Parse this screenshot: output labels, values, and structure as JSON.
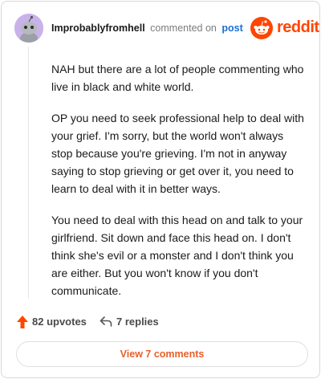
{
  "comment": {
    "username": "Improbablyfromhell",
    "action_text": "commented on",
    "post_link": "post",
    "avatar_icon": "snoo-avatar-icon",
    "paragraphs": [
      "NAH but there are a lot of people commenting who live in black and white world.",
      "OP you need to seek professional help to deal with your grief. I'm sorry, but the world won't always stop because you're grieving. I'm not in anyway saying to stop grieving or get over it, you need to learn to deal with it in better ways.",
      "You need to deal with this head on and talk to your girlfriend. Sit down and face this head on. I don't think she's evil or a monster and I don't think you are either. But you won't know if you don't communicate."
    ]
  },
  "brand": {
    "logo_text": "reddit",
    "logo_icon": "reddit-logo-icon",
    "color": "#ff4500"
  },
  "actions": {
    "upvotes": "82 upvotes",
    "upvote_icon": "upvote-arrow-icon",
    "replies": "7 replies",
    "reply_icon": "reply-arrow-icon"
  },
  "footer": {
    "view_comments": "View 7 comments",
    "accent": "#e8602c"
  }
}
